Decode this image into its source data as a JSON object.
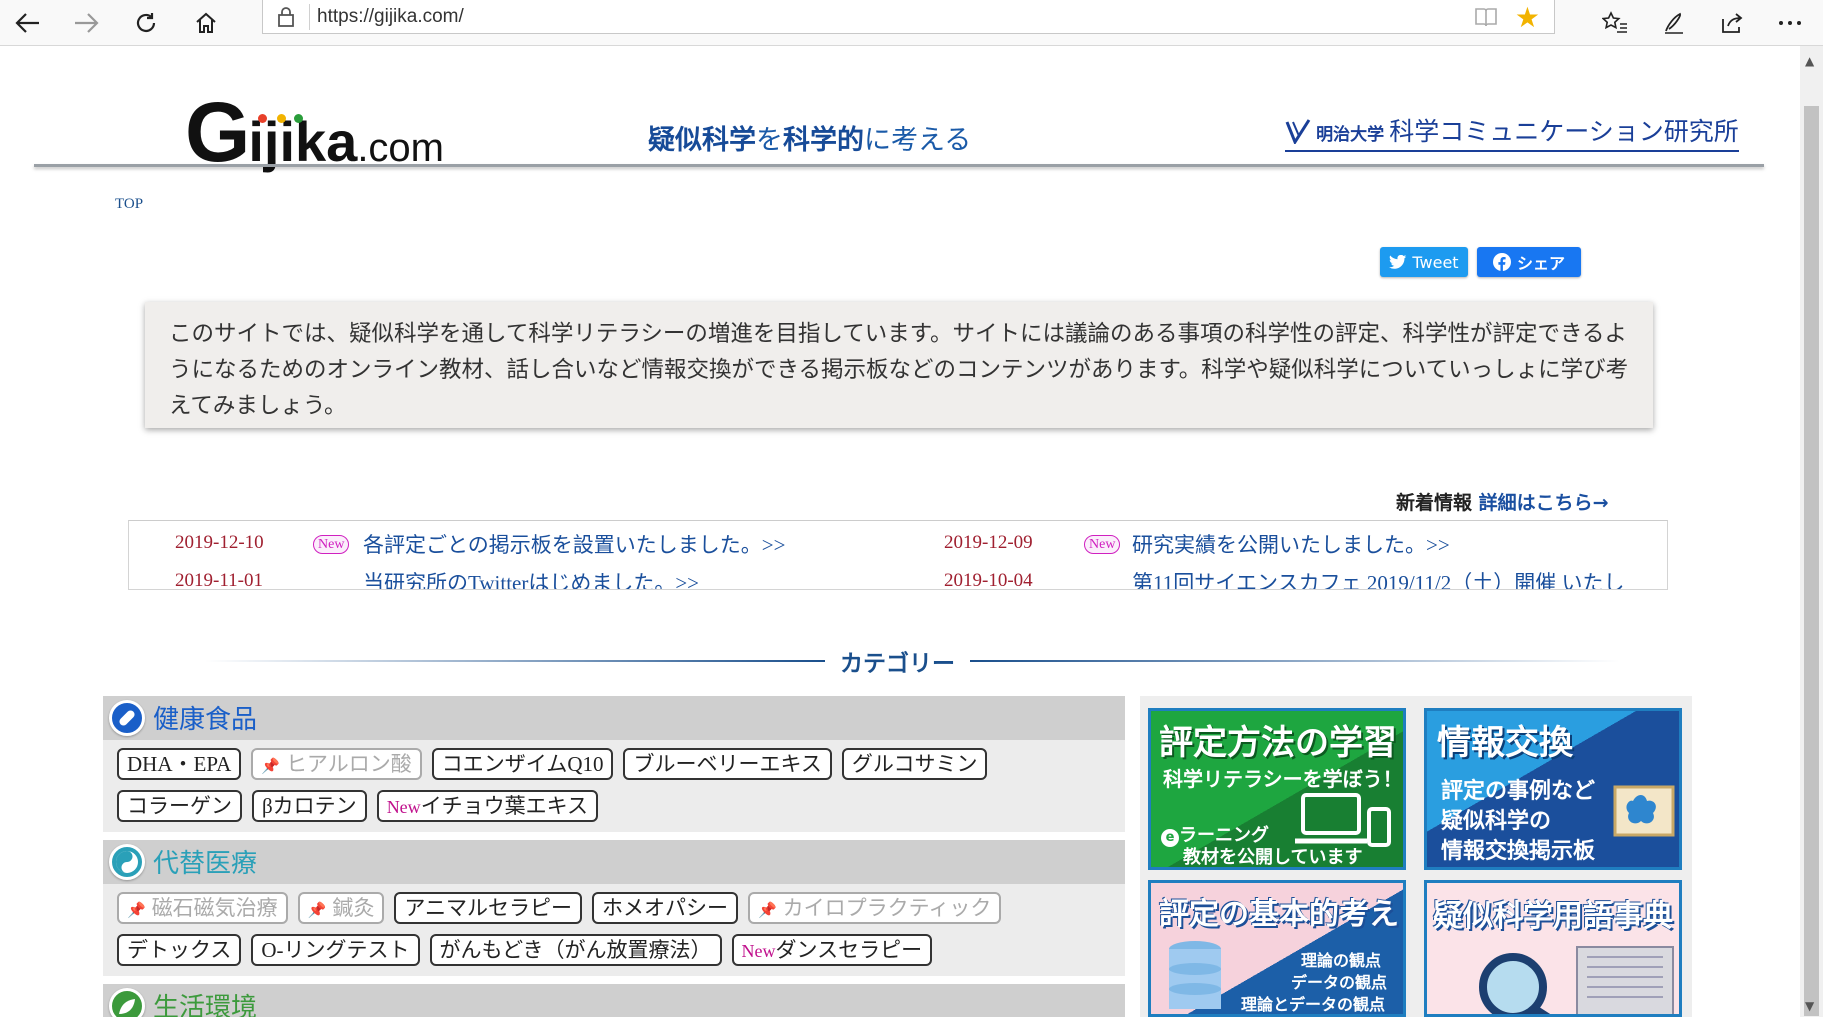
{
  "browser": {
    "url": "https://gijika.com/",
    "colors": {
      "star": "#f2b300"
    }
  },
  "header": {
    "logo": {
      "g": "G",
      "rest": "ijika",
      "suffix": ".com"
    },
    "tagline": {
      "part1": "疑似科学",
      "part2": "を",
      "part3": "科学的",
      "part4": "に考える"
    },
    "lab": {
      "univ": "明治大学",
      "name": "科学コミュニケーション研究所"
    }
  },
  "breadcrumb": "TOP",
  "share": {
    "tweet": "Tweet",
    "facebook": "シェア"
  },
  "intro": "このサイトでは、疑似科学を通して科学リテラシーの増進を目指しています。サイトには議論のある事項の科学性の評定、科学性が評定できるようになるためのオンライン教材、話し合いなど情報交換ができる掲示板などのコンテンツがあります。科学や疑似科学についていっしょに学び考えてみましょう。",
  "news": {
    "heading": "新着情報",
    "more": "詳細はこちら→",
    "new_badge": "New",
    "items": [
      {
        "date": "2019-12-10",
        "new": true,
        "text": "各評定ごとの掲示板を設置いたしました。>>"
      },
      {
        "date": "2019-12-09",
        "new": true,
        "text": "研究実績を公開いたしました。>>"
      },
      {
        "date": "2019-11-01",
        "new": false,
        "text": "当研究所のTwitterはじめました。>>"
      },
      {
        "date": "2019-10-04",
        "new": false,
        "text": "第11回サイエンスカフェ 2019/11/2（土）開催 いたし"
      }
    ]
  },
  "categories": {
    "title": "カテゴリー",
    "sections": [
      {
        "name": "健康食品",
        "color": "#1a5fc8",
        "tags": [
          {
            "label": "DHA・EPA"
          },
          {
            "label": "ヒアルロン酸",
            "disabled": true
          },
          {
            "label": "コエンザイムQ10"
          },
          {
            "label": "ブルーベリーエキス"
          },
          {
            "label": "グルコサミン"
          },
          {
            "label": "コラーゲン"
          },
          {
            "label": "βカロテン"
          },
          {
            "label": "イチョウ葉エキス",
            "new": true
          }
        ]
      },
      {
        "name": "代替医療",
        "color": "#2aa0b8",
        "tags": [
          {
            "label": "磁石磁気治療",
            "disabled": true
          },
          {
            "label": "鍼灸",
            "disabled": true
          },
          {
            "label": "アニマルセラピー"
          },
          {
            "label": "ホメオパシー"
          },
          {
            "label": "カイロプラクティック",
            "disabled": true
          },
          {
            "label": "デトックス"
          },
          {
            "label": "O-リングテスト"
          },
          {
            "label": "がんもどき（がん放置療法）"
          },
          {
            "label": "ダンスセラピー",
            "new": true
          }
        ]
      },
      {
        "name": "生活環境",
        "color": "#3c9a3c",
        "tags": []
      }
    ]
  },
  "banners": {
    "learning": {
      "title": "評定方法の学習",
      "sub": "科学リテラシーを学ぼう！",
      "foot1": "ラーニング",
      "foot2": "教材を公開しています"
    },
    "exchange": {
      "title": "情報交換",
      "line1": "評定の事例など",
      "line2": "疑似科学の",
      "line3": "情報交換掲示板"
    },
    "basics": {
      "title": "評定の基本的考え",
      "line1": "理論の観点",
      "line2": "データの観点",
      "line3": "理論とデータの観点"
    },
    "glossary": {
      "title": "疑似科学用語事典"
    }
  }
}
